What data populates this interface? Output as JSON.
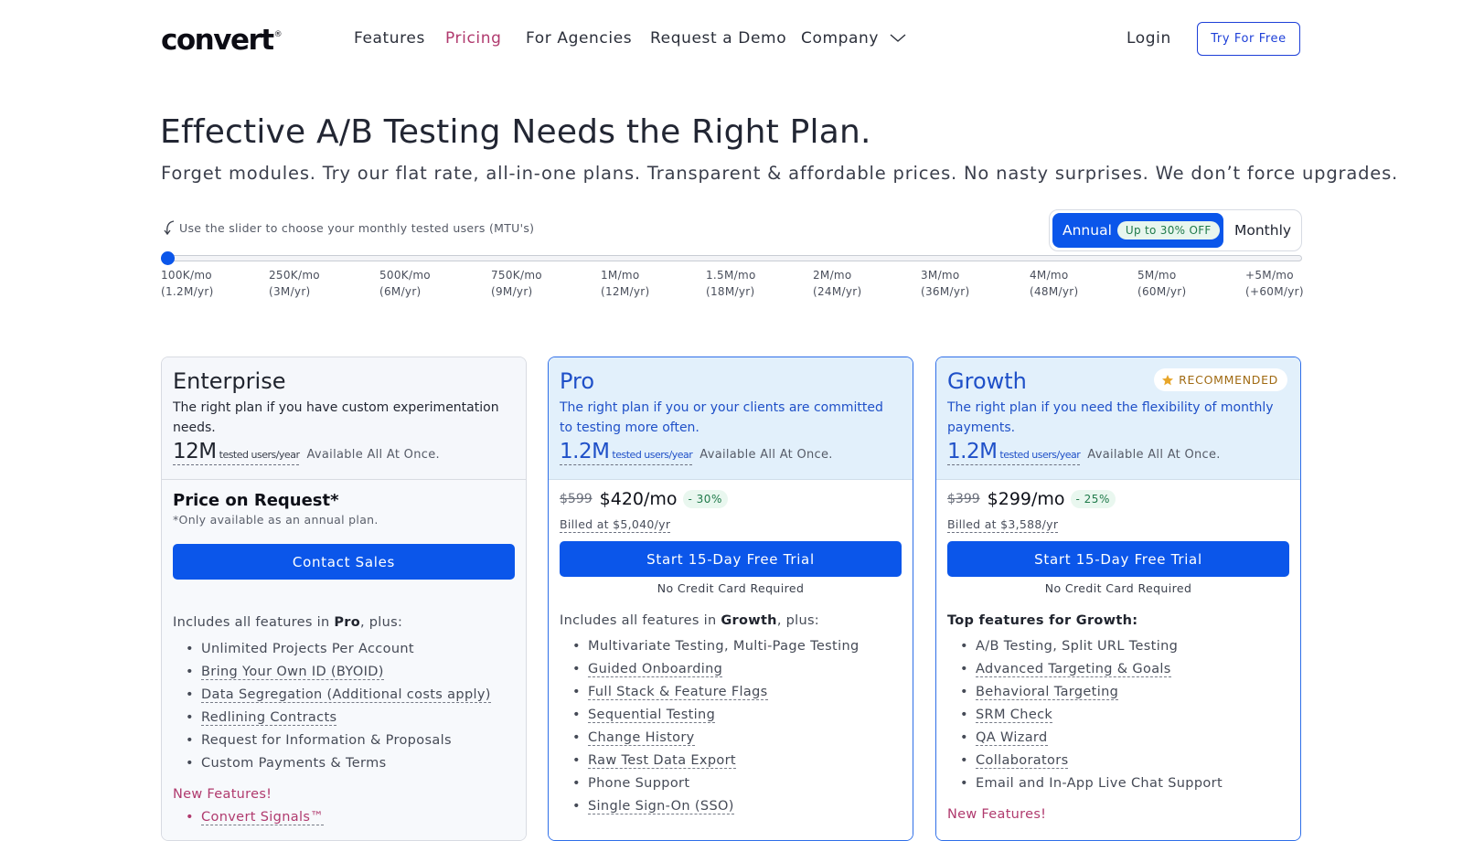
{
  "nav": {
    "logo": "convert",
    "logo_mark": "®",
    "items": [
      "Features",
      "Pricing",
      "For Agencies",
      "Request a Demo",
      "Company"
    ],
    "login": "Login",
    "cta": "Try For Free"
  },
  "hero": {
    "title": "Effective A/B Testing Needs the Right Plan.",
    "subtitle": "Forget modules. Try our flat rate, all-in-one plans. Transparent & affordable prices. No nasty surprises. We don’t force upgrades."
  },
  "slider": {
    "hint": "Use the slider to choose your monthly tested users (MTU's)",
    "value_index": 0,
    "ticks": [
      {
        "top": "100K/mo",
        "bottom": "(1.2M/yr)"
      },
      {
        "top": "250K/mo",
        "bottom": "(3M/yr)"
      },
      {
        "top": "500K/mo",
        "bottom": "(6M/yr)"
      },
      {
        "top": "750K/mo",
        "bottom": "(9M/yr)"
      },
      {
        "top": "1M/mo",
        "bottom": "(12M/yr)"
      },
      {
        "top": "1.5M/mo",
        "bottom": "(18M/yr)"
      },
      {
        "top": "2M/mo",
        "bottom": "(24M/yr)"
      },
      {
        "top": "3M/mo",
        "bottom": "(36M/yr)"
      },
      {
        "top": "4M/mo",
        "bottom": "(48M/yr)"
      },
      {
        "top": "5M/mo",
        "bottom": "(60M/yr)"
      },
      {
        "top": "+5M/mo",
        "bottom": "(+60M/yr)"
      }
    ]
  },
  "billing": {
    "annual": "Annual",
    "annual_badge": "Up to 30% OFF",
    "monthly": "Monthly",
    "selected": "Annual"
  },
  "plans": {
    "enterprise": {
      "name": "Enterprise",
      "desc": "The right plan if you have custom experimentation needs.",
      "mtu": "12M",
      "mtu_unit": "tested users/year",
      "available": "Available All At Once.",
      "price": "Price on Request*",
      "price_note": "*Only available as an annual plan.",
      "cta": "Contact Sales",
      "includes_pre": "Includes all features in ",
      "includes_plan": "Pro",
      "includes_post": ", plus:",
      "features": [
        "Unlimited Projects Per Account",
        "Bring Your Own ID (BYOID)",
        "Data Segregation (Additional costs apply)",
        "Redlining Contracts",
        "Request for Information & Proposals",
        "Custom Payments & Terms"
      ],
      "new_title": "New Features!",
      "new_features": [
        "Convert Signals™"
      ]
    },
    "pro": {
      "name": "Pro",
      "desc": "The right plan if you or your clients are committed to testing more often.",
      "mtu": "1.2M",
      "mtu_unit": "tested users/year",
      "available": "Available All At Once.",
      "old_price": "$599",
      "price": "$420/mo",
      "discount": "- 30%",
      "billed": "Billed at $5,040/yr",
      "cta": "Start 15-Day Free Trial",
      "no_cc": "No Credit Card Required",
      "includes_pre": "Includes all features in ",
      "includes_plan": "Growth",
      "includes_post": ", plus:",
      "features": [
        "Multivariate Testing, Multi-Page Testing",
        "Guided Onboarding",
        "Full Stack & Feature Flags",
        "Sequential Testing",
        "Change History",
        "Raw Test Data Export",
        "Phone Support",
        "Single Sign-On (SSO)"
      ]
    },
    "growth": {
      "name": "Growth",
      "badge": "RECOMMENDED",
      "desc": "The right plan if you need the flexibility of monthly payments.",
      "mtu": "1.2M",
      "mtu_unit": "tested users/year",
      "available": "Available All At Once.",
      "old_price": "$399",
      "price": "$299/mo",
      "discount": "- 25%",
      "billed": "Billed at $3,588/yr",
      "cta": "Start 15-Day Free Trial",
      "no_cc": "No Credit Card Required",
      "top_title": "Top features for Growth:",
      "features": [
        "A/B Testing, Split URL Testing",
        "Advanced Targeting & Goals",
        "Behavioral Targeting",
        "SRM Check",
        "QA Wizard",
        "Collaborators",
        "Email and In-App Live Chat Support"
      ],
      "new_title": "New Features!"
    }
  },
  "colors": {
    "primary": "#0b56ea",
    "accent_pink": "#b03a6e",
    "plan_blue": "#1f50c8",
    "card_tint": "#e2f0fb"
  }
}
